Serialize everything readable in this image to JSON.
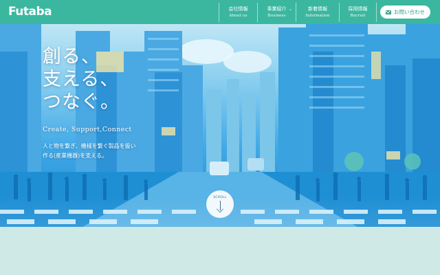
{
  "brand": {
    "logo_text": "Futaba"
  },
  "nav": {
    "items": [
      {
        "jp": "会社情報",
        "en": "About us",
        "has_submenu": false
      },
      {
        "jp": "事業紹介",
        "en": "Business",
        "has_submenu": true
      },
      {
        "jp": "新着情報",
        "en": "Information",
        "has_submenu": false
      },
      {
        "jp": "採用情報",
        "en": "Recruit",
        "has_submenu": false
      }
    ],
    "contact_label": "お問い合わせ",
    "contact_icon": "mail-icon"
  },
  "hero": {
    "headline": [
      "創る、",
      "支える、",
      "つなぐ。"
    ],
    "tagline_en": "Create, Support,Connect",
    "description": [
      "人と物を繋ぎ、機械を繋ぐ製品を扱い",
      "作る(産業機器)を支える。"
    ],
    "scroll_label": "SCROLL",
    "scroll_icon": "arrow-down-icon"
  },
  "colors": {
    "header": "#3bb7a0",
    "accent_text": "#2aa08a",
    "page_bg": "#cfeae6",
    "hero_blue": "#1a86cf"
  }
}
